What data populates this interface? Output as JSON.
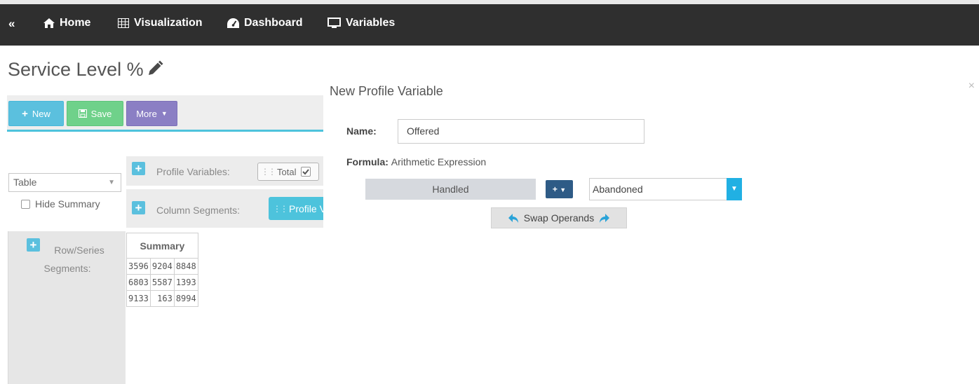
{
  "nav": {
    "collapse_glyph": "«",
    "items": [
      {
        "label": "Home",
        "icon": "home-icon"
      },
      {
        "label": "Visualization",
        "icon": "table-icon"
      },
      {
        "label": "Dashboard",
        "icon": "dashboard-icon"
      },
      {
        "label": "Variables",
        "icon": "monitor-icon"
      }
    ]
  },
  "page": {
    "title": "Service Level %",
    "edit_icon": "pencil-icon"
  },
  "toolbar": {
    "new_label": "New",
    "save_label": "Save",
    "more_label": "More"
  },
  "left": {
    "viz_type": "Table",
    "hide_summary_label": "Hide Summary"
  },
  "segments": {
    "profile_label": "Profile Variables:",
    "profile_chip": "Total",
    "column_label": "Column Segments:",
    "column_chip": "Profile V",
    "row_label_1": "Row/Series",
    "row_label_2": "Segments:"
  },
  "summary_table": {
    "header": "Summary",
    "rows": [
      [
        "3596",
        "9204",
        "8848"
      ],
      [
        "6803",
        "5587",
        "1393"
      ],
      [
        "9133",
        "163",
        "8994"
      ]
    ]
  },
  "modal": {
    "title": "New Profile Variable",
    "close_glyph": "×",
    "name_label": "Name:",
    "name_value": "Offered",
    "formula_label": "Formula:",
    "formula_type": "Arithmetic Expression",
    "left_operand": "Handled",
    "operator": "+",
    "right_operand": "Abandoned",
    "swap_label": "Swap Operands"
  },
  "colors": {
    "topbar": "#2f2f2f",
    "new_button": "#5bc0de",
    "save_button": "#6fd18a",
    "more_button": "#8b7fc4",
    "operator_button": "#2e5b86",
    "dropdown_accent": "#21b0e3"
  }
}
